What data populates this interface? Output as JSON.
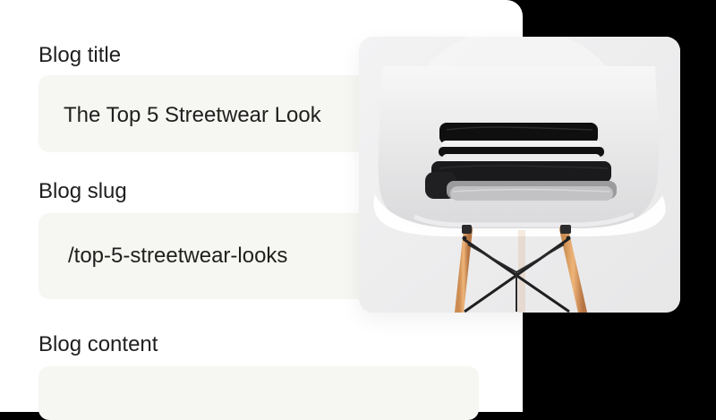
{
  "form": {
    "fields": [
      {
        "label": "Blog title",
        "value": "The Top 5 Streetwear Look"
      },
      {
        "label": "Blog slug",
        "value": "/top-5-streetwear-looks"
      },
      {
        "label": "Blog content",
        "value": ""
      }
    ]
  },
  "image": {
    "subject": "folded clothes on white chair"
  },
  "colors": {
    "background": "#000000",
    "card": "#ffffff",
    "field_fill": "#f6f6f2",
    "text": "#1f1f1f",
    "image_bg": "#ececed"
  }
}
